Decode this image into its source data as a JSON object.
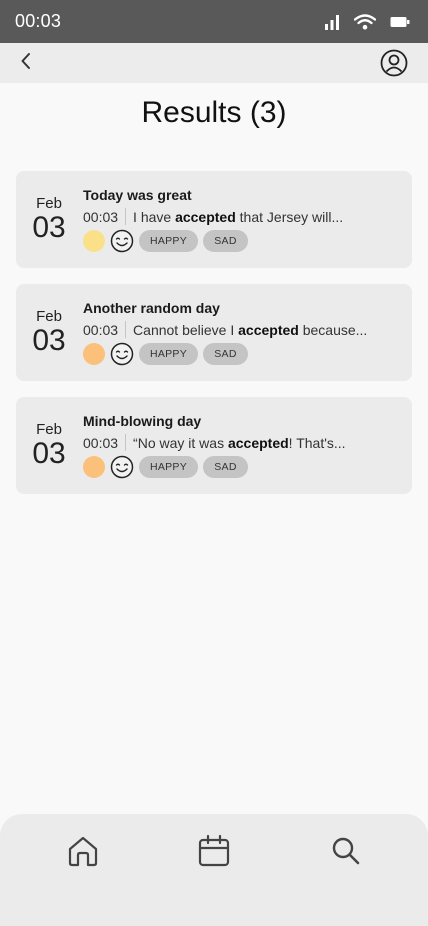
{
  "status_bar": {
    "time": "00:03"
  },
  "header": {
    "title": "Results (3)"
  },
  "results": [
    {
      "month": "Feb",
      "day": "03",
      "title": "Today was great",
      "time": "00:03",
      "snippet_before": "I have ",
      "snippet_highlight": "accepted",
      "snippet_after": " that Jersey will...",
      "mood_color": "#fbe08a",
      "tags": [
        "HAPPY",
        "SAD"
      ]
    },
    {
      "month": "Feb",
      "day": "03",
      "title": "Another random day",
      "time": "00:03",
      "snippet_before": "Cannot believe I ",
      "snippet_highlight": "accepted",
      "snippet_after": " because...",
      "mood_color": "#fbc07a",
      "tags": [
        "HAPPY",
        "SAD"
      ]
    },
    {
      "month": "Feb",
      "day": "03",
      "title": "Mind-blowing day",
      "time": "00:03",
      "snippet_before": "“No way it was ",
      "snippet_highlight": "accepted",
      "snippet_after": "! That's...",
      "mood_color": "#fbc07a",
      "tags": [
        "HAPPY",
        "SAD"
      ]
    }
  ],
  "icons": {
    "status": [
      "signal-icon",
      "wifi-icon",
      "battery-icon"
    ],
    "topbar": [
      "back-chevron-icon",
      "profile-icon"
    ],
    "nav": [
      "home-icon",
      "calendar-icon",
      "search-icon"
    ],
    "mood_face": "smiling-face-icon"
  },
  "colors": {
    "status_bar_bg": "#595959",
    "topbar_bg": "#ececec",
    "card_bg": "#ebebeb",
    "tag_bg": "#c4c4c4",
    "nav_bg": "#ebebeb"
  }
}
